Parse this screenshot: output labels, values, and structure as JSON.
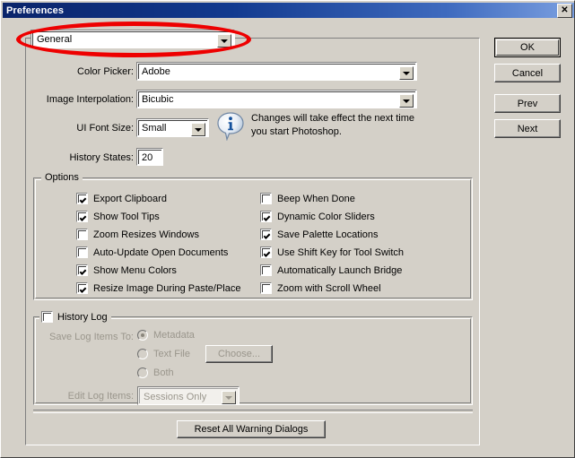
{
  "window": {
    "title": "Preferences",
    "close_label": "✕",
    "bg_color": "#d4d0c8",
    "titlebar_color": "#0a246a",
    "annotation_color": "#ee0000"
  },
  "section_selector": {
    "name": "preferences-section",
    "value": "General",
    "arrow": "chevron-down-icon"
  },
  "fields": [
    {
      "label": "Color Picker:",
      "value": "Adobe",
      "type": "combo"
    },
    {
      "label": "Image Interpolation:",
      "value": "Bicubic",
      "type": "combo"
    },
    {
      "label": "UI Font Size:",
      "value": "Small",
      "type": "combo"
    },
    {
      "label": "History States:",
      "value": "20",
      "type": "text"
    }
  ],
  "info_note": {
    "icon": "info-bubble-icon",
    "text": "Changes will take effect the next time you start Photoshop."
  },
  "options_group": {
    "title": "Options",
    "left_column": [
      {
        "label": "Export Clipboard",
        "checked": true
      },
      {
        "label": "Show Tool Tips",
        "checked": true
      },
      {
        "label": "Zoom Resizes Windows",
        "checked": false
      },
      {
        "label": "Auto-Update Open Documents",
        "checked": false
      },
      {
        "label": "Show Menu Colors",
        "checked": true
      },
      {
        "label": "Resize Image During Paste/Place",
        "checked": true
      }
    ],
    "right_column": [
      {
        "label": "Beep When Done",
        "checked": false
      },
      {
        "label": "Dynamic Color Sliders",
        "checked": true
      },
      {
        "label": "Save Palette Locations",
        "checked": true
      },
      {
        "label": "Use Shift Key for Tool Switch",
        "checked": true
      },
      {
        "label": "Automatically Launch Bridge",
        "checked": false
      },
      {
        "label": "Zoom with Scroll Wheel",
        "checked": false
      }
    ]
  },
  "history_log_group": {
    "title": "History Log",
    "enabled": false,
    "checked": false,
    "save_to_label": "Save Log Items To:",
    "radios": [
      {
        "label": "Metadata",
        "selected": true
      },
      {
        "label": "Text File",
        "selected": false
      },
      {
        "label": "Both",
        "selected": false
      }
    ],
    "choose_button": "Choose...",
    "edit_items_label": "Edit Log Items:",
    "edit_items_value": "Sessions Only"
  },
  "reset_button": {
    "label": "Reset All Warning Dialogs"
  },
  "action_buttons": [
    {
      "label": "OK",
      "default": true
    },
    {
      "label": "Cancel",
      "default": false
    },
    {
      "label": "Prev",
      "default": false
    },
    {
      "label": "Next",
      "default": false
    }
  ]
}
